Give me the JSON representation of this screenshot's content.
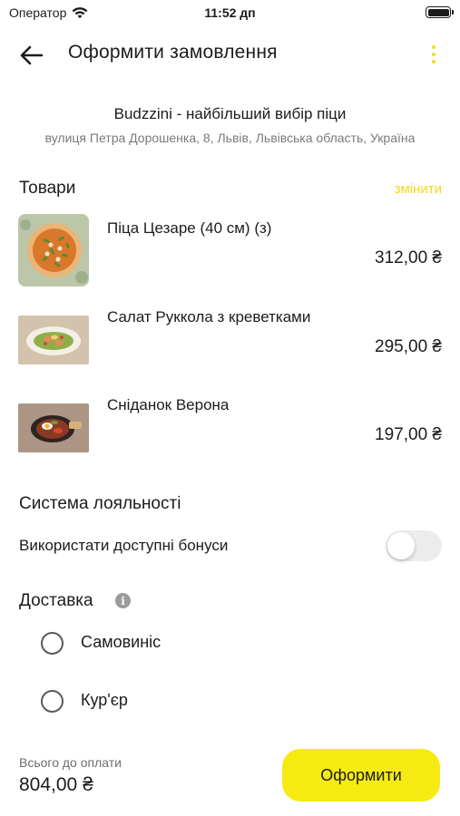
{
  "status_bar": {
    "carrier": "Оператор",
    "time": "11:52 дп"
  },
  "header": {
    "title": "Оформити замовлення",
    "back_icon": "arrow-left-icon",
    "menu_icon": "more-vertical-icon"
  },
  "restaurant": {
    "name": "Budzzini - найбільший вибір піци",
    "address": "вулиця Петра Дорошенка, 8, Львів, Львівська область, Україна"
  },
  "products": {
    "title": "Товари",
    "change_label": "змінити",
    "items": [
      {
        "name": "Піца Цезаре (40 см) (з)",
        "price": "312,00 ₴"
      },
      {
        "name": "Салат Руккола з креветками",
        "price": "295,00 ₴"
      },
      {
        "name": "Сніданок Верона",
        "price": "197,00 ₴"
      }
    ]
  },
  "loyalty": {
    "title": "Система лояльності",
    "use_bonuses_label": "Використати доступні бонуси",
    "use_bonuses_enabled": false
  },
  "delivery": {
    "title": "Доставка",
    "info_icon": "info-icon",
    "options": [
      {
        "label": "Самовиніс",
        "selected": false
      },
      {
        "label": "Кур'єр",
        "selected": false
      }
    ]
  },
  "footer": {
    "total_label": "Всього до оплати",
    "total_value": "804,00 ₴",
    "checkout_label": "Оформити"
  },
  "colors": {
    "accent": "#f6ea13",
    "link": "#f2d81a",
    "text": "#1c1c1c",
    "secondary_text": "#7a7a7a"
  }
}
